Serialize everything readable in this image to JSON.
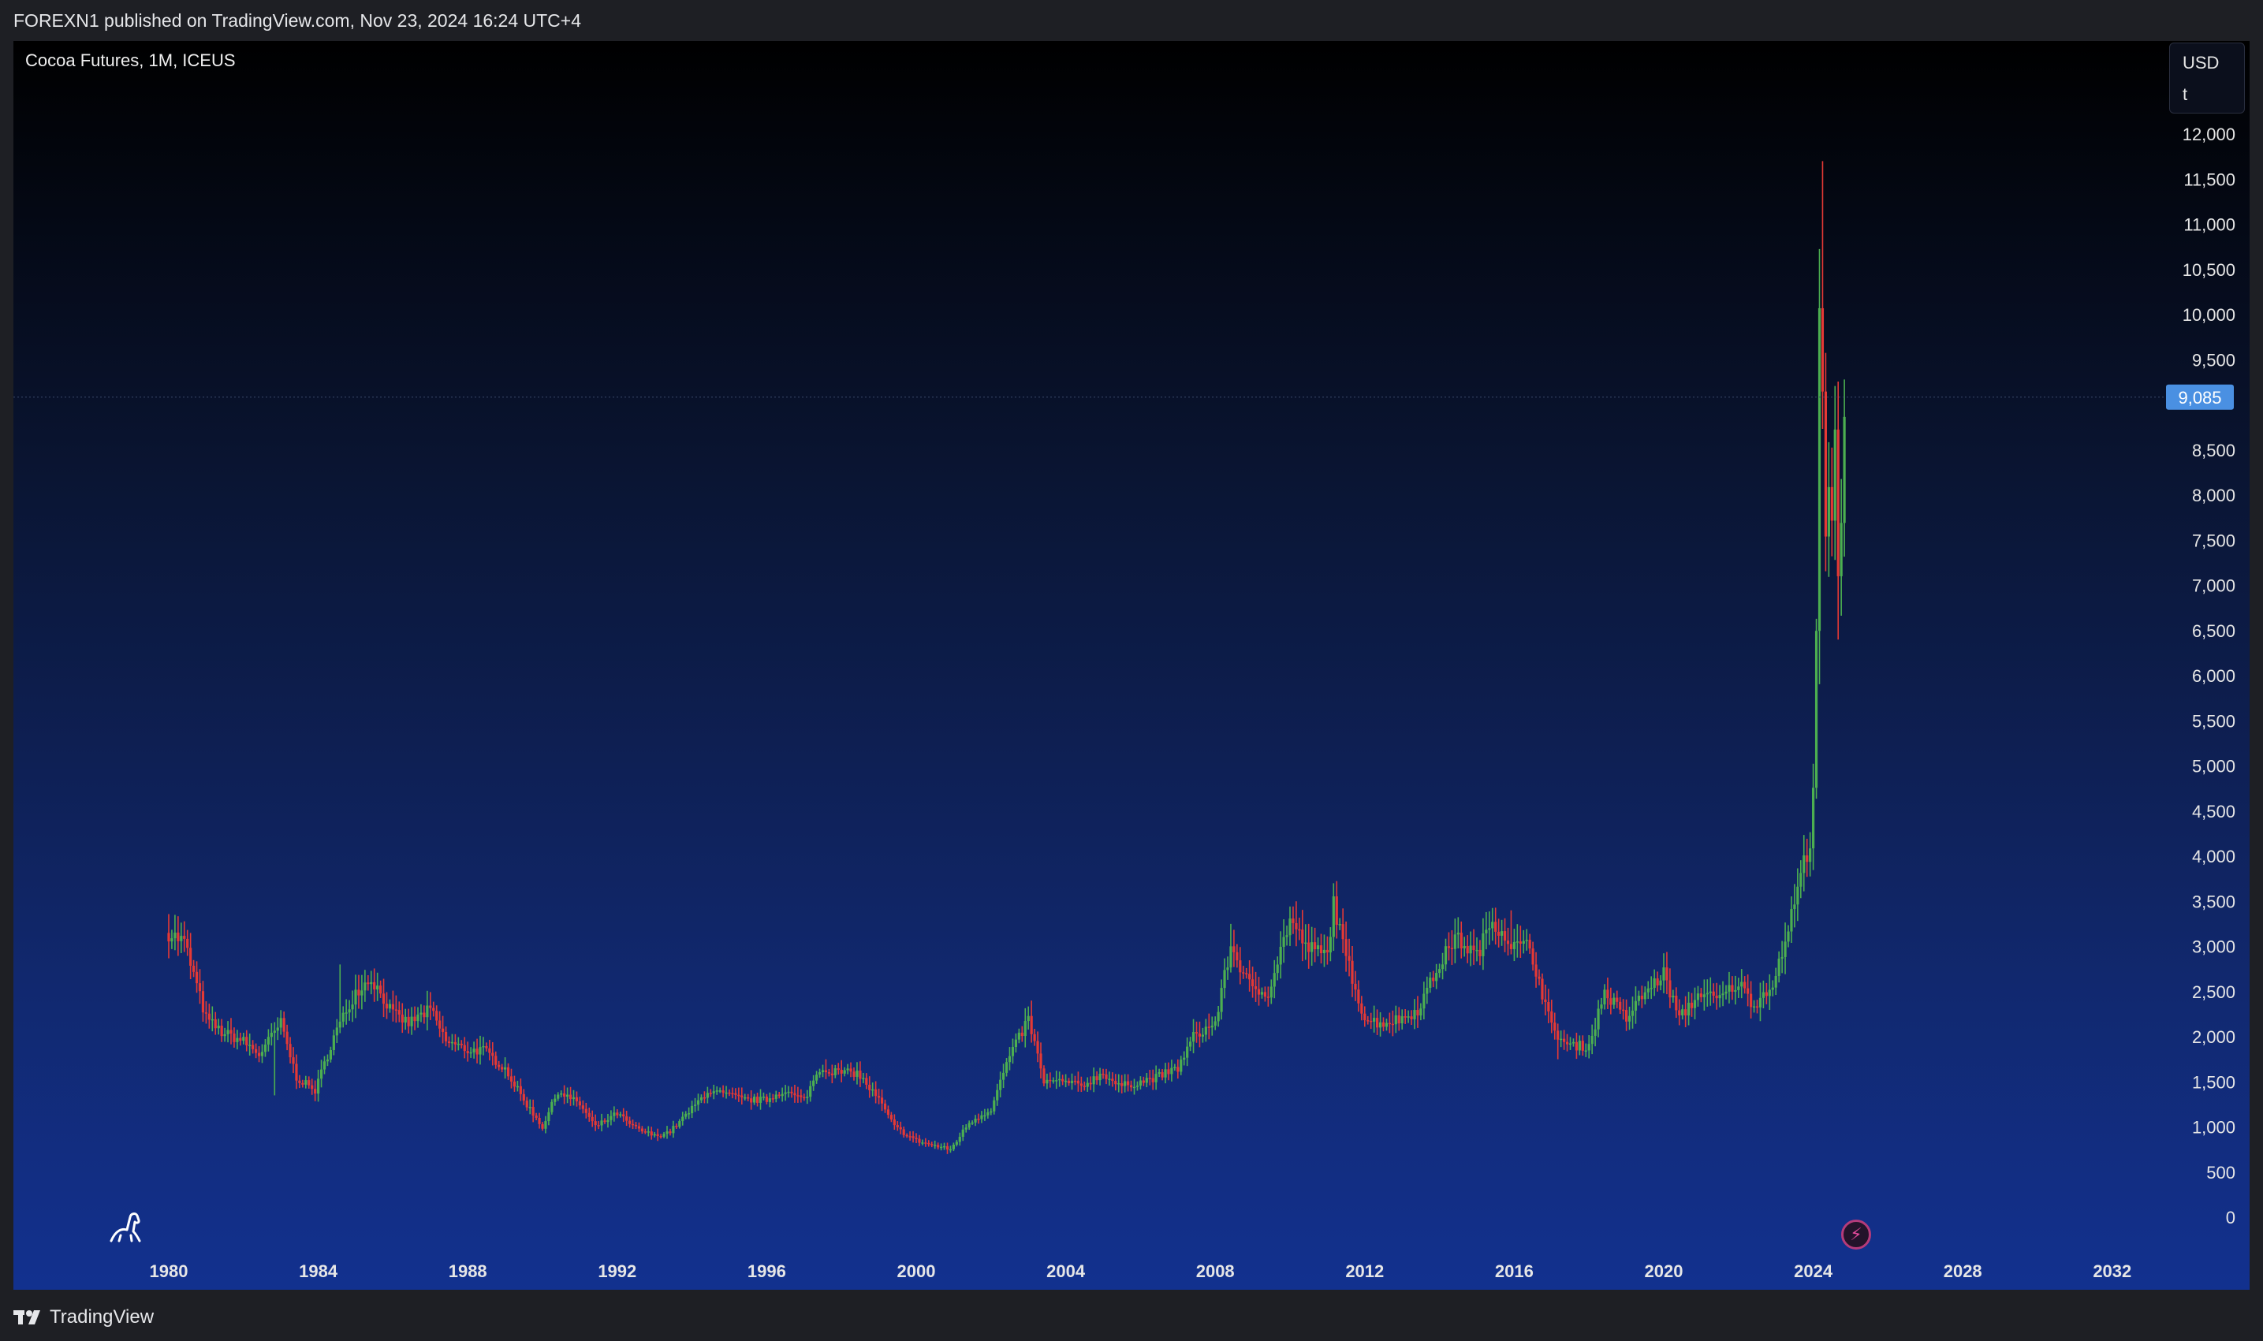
{
  "header": {
    "published_text": "FOREXN1 published on TradingView.com, Nov 23, 2024 16:24 UTC+4"
  },
  "chart": {
    "symbol_line": "Cocoa Futures, 1M, ICEUS",
    "currency": "USD",
    "unit": "t",
    "current_price_label": "9,085"
  },
  "footer": {
    "brand": "TradingView"
  },
  "icons": {
    "logo": "tradingview-logo-icon",
    "bottom_left": "dinosaur-icon",
    "event_marker": "lightning-icon"
  },
  "colors": {
    "up": "#4caf50",
    "down": "#e53935",
    "price_tag_bg": "#4a90e2",
    "axis_text": "#e6e6e6"
  },
  "chart_data": {
    "type": "candlestick",
    "timeframe": "1M",
    "x_tick_labels": [
      "1980",
      "1984",
      "1988",
      "1992",
      "1996",
      "2000",
      "2004",
      "2008",
      "2012",
      "2016",
      "2020",
      "2024",
      "2028",
      "2032"
    ],
    "x_tick_years": [
      1980,
      1984,
      1988,
      1992,
      1996,
      2000,
      2004,
      2008,
      2012,
      2016,
      2020,
      2024,
      2028,
      2032
    ],
    "y_tick_labels": [
      "12,000",
      "11,500",
      "11,000",
      "10,500",
      "10,000",
      "9,500",
      "8,500",
      "8,000",
      "7,500",
      "7,000",
      "6,500",
      "6,000",
      "5,500",
      "5,000",
      "4,500",
      "4,000",
      "3,500",
      "3,000",
      "2,500",
      "2,000",
      "1,500",
      "1,000",
      "500",
      "0"
    ],
    "y_tick_values": [
      12000,
      11500,
      11000,
      10500,
      10000,
      9500,
      8500,
      8000,
      7500,
      7000,
      6500,
      6000,
      5500,
      5000,
      4500,
      4000,
      3500,
      3000,
      2500,
      2000,
      1500,
      1000,
      500,
      0
    ],
    "ylim": [
      0,
      12000
    ],
    "last_price": 9085,
    "grid": false,
    "close_path": [
      [
        "1980-01",
        3150
      ],
      [
        "1980-06",
        3050
      ],
      [
        "1981-01",
        2200
      ],
      [
        "1981-06",
        2050
      ],
      [
        "1982-01",
        1950
      ],
      [
        "1982-06",
        1800
      ],
      [
        "1983-01",
        2150
      ],
      [
        "1983-06",
        1550
      ],
      [
        "1983-12",
        1400
      ],
      [
        "1984-06",
        2000
      ],
      [
        "1985-01",
        2500
      ],
      [
        "1985-06",
        2650
      ],
      [
        "1986-01",
        2250
      ],
      [
        "1986-06",
        2150
      ],
      [
        "1987-01",
        2300
      ],
      [
        "1987-06",
        1950
      ],
      [
        "1988-01",
        1850
      ],
      [
        "1988-06",
        1850
      ],
      [
        "1989-01",
        1650
      ],
      [
        "1989-06",
        1350
      ],
      [
        "1990-01",
        1000
      ],
      [
        "1990-06",
        1400
      ],
      [
        "1991-01",
        1250
      ],
      [
        "1991-06",
        1000
      ],
      [
        "1992-01",
        1150
      ],
      [
        "1992-06",
        1000
      ],
      [
        "1993-01",
        900
      ],
      [
        "1993-06",
        950
      ],
      [
        "1994-01",
        1200
      ],
      [
        "1994-06",
        1400
      ],
      [
        "1995-01",
        1350
      ],
      [
        "1995-06",
        1300
      ],
      [
        "1996-01",
        1300
      ],
      [
        "1996-06",
        1400
      ],
      [
        "1997-01",
        1300
      ],
      [
        "1997-06",
        1650
      ],
      [
        "1998-01",
        1600
      ],
      [
        "1998-06",
        1600
      ],
      [
        "1999-01",
        1300
      ],
      [
        "1999-06",
        1000
      ],
      [
        "2000-01",
        850
      ],
      [
        "2000-06",
        800
      ],
      [
        "2000-12",
        750
      ],
      [
        "2001-06",
        1050
      ],
      [
        "2002-01",
        1200
      ],
      [
        "2002-06",
        1700
      ],
      [
        "2003-01",
        2200
      ],
      [
        "2003-06",
        1500
      ],
      [
        "2004-01",
        1500
      ],
      [
        "2004-06",
        1450
      ],
      [
        "2005-01",
        1600
      ],
      [
        "2005-06",
        1450
      ],
      [
        "2006-01",
        1500
      ],
      [
        "2006-06",
        1550
      ],
      [
        "2007-01",
        1650
      ],
      [
        "2007-06",
        2000
      ],
      [
        "2008-01",
        2150
      ],
      [
        "2008-06",
        3000
      ],
      [
        "2009-01",
        2500
      ],
      [
        "2009-06",
        2500
      ],
      [
        "2010-01",
        3300
      ],
      [
        "2010-06",
        3000
      ],
      [
        "2011-01",
        2900
      ],
      [
        "2011-03",
        3500
      ],
      [
        "2011-06",
        3000
      ],
      [
        "2012-01",
        2200
      ],
      [
        "2012-06",
        2150
      ],
      [
        "2013-01",
        2200
      ],
      [
        "2013-06",
        2300
      ],
      [
        "2014-01",
        2800
      ],
      [
        "2014-06",
        3100
      ],
      [
        "2015-01",
        2900
      ],
      [
        "2015-06",
        3300
      ],
      [
        "2016-01",
        3000
      ],
      [
        "2016-06",
        3000
      ],
      [
        "2017-01",
        2100
      ],
      [
        "2017-06",
        1900
      ],
      [
        "2018-01",
        1900
      ],
      [
        "2018-06",
        2500
      ],
      [
        "2019-01",
        2200
      ],
      [
        "2019-06",
        2450
      ],
      [
        "2020-01",
        2700
      ],
      [
        "2020-06",
        2200
      ],
      [
        "2021-01",
        2500
      ],
      [
        "2021-06",
        2400
      ],
      [
        "2022-01",
        2600
      ],
      [
        "2022-06",
        2350
      ],
      [
        "2023-01",
        2650
      ],
      [
        "2023-06",
        3350
      ],
      [
        "2023-12",
        4200
      ],
      [
        "2024-01",
        4800
      ],
      [
        "2024-02",
        6500
      ],
      [
        "2024-03",
        9800
      ],
      [
        "2024-04",
        9000
      ],
      [
        "2024-05",
        7500
      ],
      [
        "2024-06",
        8000
      ],
      [
        "2024-07",
        7800
      ],
      [
        "2024-08",
        8500
      ],
      [
        "2024-09",
        7000
      ],
      [
        "2024-10",
        7600
      ],
      [
        "2024-11",
        9085
      ]
    ],
    "highs": [
      [
        "1980-03",
        3350
      ],
      [
        "1984-08",
        2800
      ],
      [
        "1997-08",
        1750
      ],
      [
        "2003-02",
        2400
      ],
      [
        "2008-06",
        3250
      ],
      [
        "2010-03",
        3500
      ],
      [
        "2011-03",
        3700
      ],
      [
        "2015-12",
        3400
      ],
      [
        "2024-04",
        11700
      ],
      [
        "2024-12",
        9300
      ]
    ],
    "lows": [
      [
        "1982-11",
        1350
      ],
      [
        "2000-11",
        700
      ],
      [
        "2017-03",
        1750
      ],
      [
        "2024-09",
        6400
      ]
    ]
  }
}
